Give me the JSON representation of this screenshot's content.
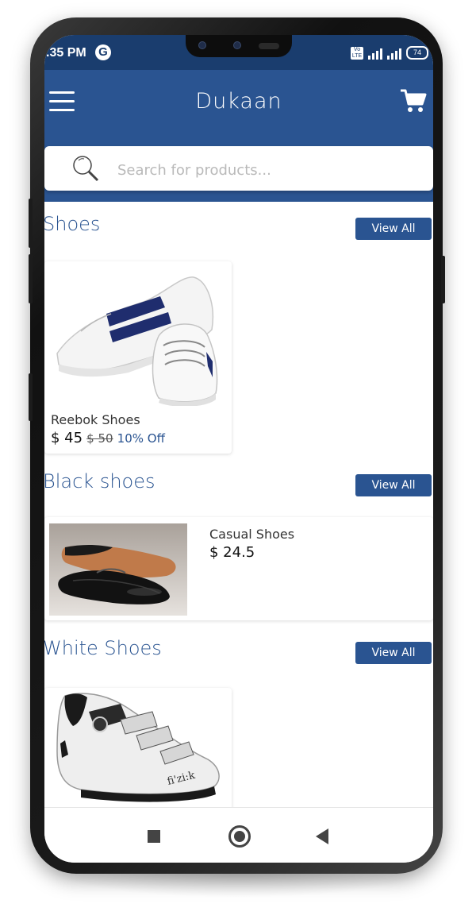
{
  "status_bar": {
    "time": ".35 PM",
    "carrier_icon": "G",
    "volte": "Vo LTE",
    "network": "4G",
    "battery": "74"
  },
  "header": {
    "title": "Dukaan",
    "menu_icon": "hamburger-menu-icon",
    "cart_icon": "shopping-cart-icon"
  },
  "search": {
    "placeholder": "Search for products..."
  },
  "sections": [
    {
      "title": "Shoes",
      "view_all_label": "View All",
      "products": [
        {
          "name": "Reebok Shoes",
          "price": "$ 45",
          "old_price": "$ 50",
          "discount": "10% Off",
          "image": "white-sneakers-image"
        }
      ]
    },
    {
      "title": "Black shoes",
      "view_all_label": "View All",
      "products": [
        {
          "name": "Casual Shoes",
          "price": "$ 24.5",
          "image": "black-formal-shoes-image"
        }
      ]
    },
    {
      "title": "White Shoes",
      "view_all_label": "View All",
      "products": [
        {
          "image": "white-cycling-shoe-image",
          "brand_text": "fi'zi:k"
        }
      ]
    }
  ],
  "navigation": {
    "recents_icon": "square-icon",
    "home_icon": "circle-home-icon",
    "back_icon": "triangle-back-icon"
  },
  "colors": {
    "primary": "#2a5491",
    "status_bar": "#1a3d6e"
  }
}
